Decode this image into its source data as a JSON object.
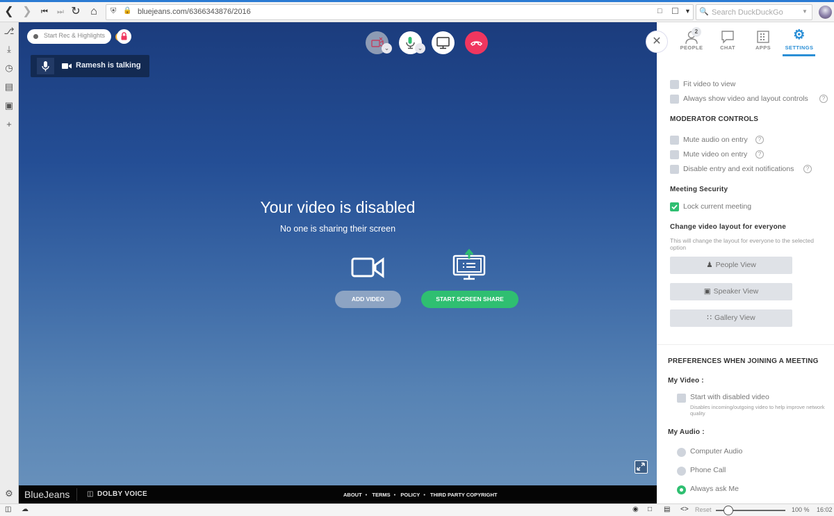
{
  "browser": {
    "url": "bluejeans.com/6366343876/2016",
    "search_placeholder": "Search DuckDuckGo",
    "nav": [
      "back-icon",
      "forward-icon",
      "skip-back-icon",
      "skip-forward-icon",
      "reload-icon",
      "home-icon"
    ]
  },
  "sidebar_icons": [
    "bookmark-icon",
    "download-icon",
    "history-icon",
    "notes-icon",
    "window-icon",
    "add-icon",
    "settings-icon"
  ],
  "meeting": {
    "rec_label": "Start Rec & Highlights",
    "rec_help": "?",
    "talking_label": "Ramesh is talking",
    "title": "Your video is disabled",
    "subtitle": "No one is sharing their screen",
    "add_video": "ADD VIDEO",
    "start_share": "START SCREEN SHARE",
    "colors": {
      "share_green": "#2fbf71",
      "hangup_red": "#f0365f"
    }
  },
  "footer": {
    "brand": "BlueJeans",
    "dolby": "DOLBY VOICE",
    "links": [
      "ABOUT",
      "TERMS",
      "POLICY",
      "THIRD PARTY COPYRIGHT"
    ]
  },
  "panel": {
    "tabs": [
      {
        "label": "PEOPLE",
        "badge": "2"
      },
      {
        "label": "CHAT"
      },
      {
        "label": "APPS"
      },
      {
        "label": "SETTINGS",
        "active": true
      }
    ],
    "general": [
      {
        "label": "Fit video to view",
        "checked": false
      },
      {
        "label": "Always show video and layout controls",
        "checked": false,
        "help": true
      }
    ],
    "moderator_heading": "MODERATOR CONTROLS",
    "moderator": [
      {
        "label": "Mute audio on entry",
        "checked": false
      },
      {
        "label": "Mute video on entry",
        "checked": false
      },
      {
        "label": "Disable entry and exit notifications",
        "checked": false
      }
    ],
    "security_heading": "Meeting Security",
    "security": {
      "label": "Lock current meeting",
      "checked": true
    },
    "layout_heading": "Change video layout for everyone",
    "layout_desc": "This will change the layout for everyone to the selected option",
    "layouts": [
      "People View",
      "Speaker View",
      "Gallery View"
    ],
    "prefs_heading": "PREFERENCES WHEN JOINING A MEETING",
    "my_video": "My Video :",
    "start_disabled": {
      "label": "Start with disabled video",
      "checked": false
    },
    "start_disabled_desc": "Disables incoming/outgoing video to help improve network quality",
    "my_audio": "My Audio :",
    "audio_options": [
      {
        "label": "Computer Audio",
        "selected": false
      },
      {
        "label": "Phone Call",
        "selected": false
      },
      {
        "label": "Always ask Me",
        "selected": true
      }
    ]
  },
  "statusbar": {
    "reset": "Reset",
    "zoom": "100 %",
    "time": "16:02"
  }
}
